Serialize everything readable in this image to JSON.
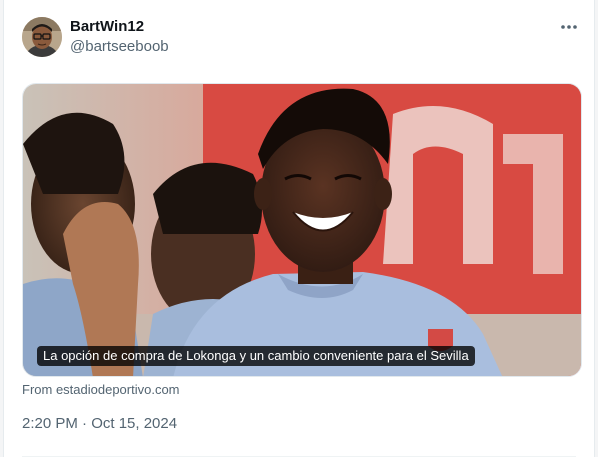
{
  "tweet": {
    "author": {
      "name": "BartWin12",
      "handle": "@bartseeboob",
      "avatar_icon": "person-with-glasses-avatar"
    },
    "more_icon": "more-horizontal-icon",
    "media": {
      "caption": "La opción de compra de Lokonga y un cambio conveniente para el Sevilla",
      "source": "From estadiodeportivo.com"
    },
    "timestamp": "2:20 PM · Oct 15, 2024"
  },
  "colors": {
    "text_primary": "#0f1419",
    "text_secondary": "#536471",
    "background": "#ffffff",
    "banner_red": "#d6453f"
  }
}
